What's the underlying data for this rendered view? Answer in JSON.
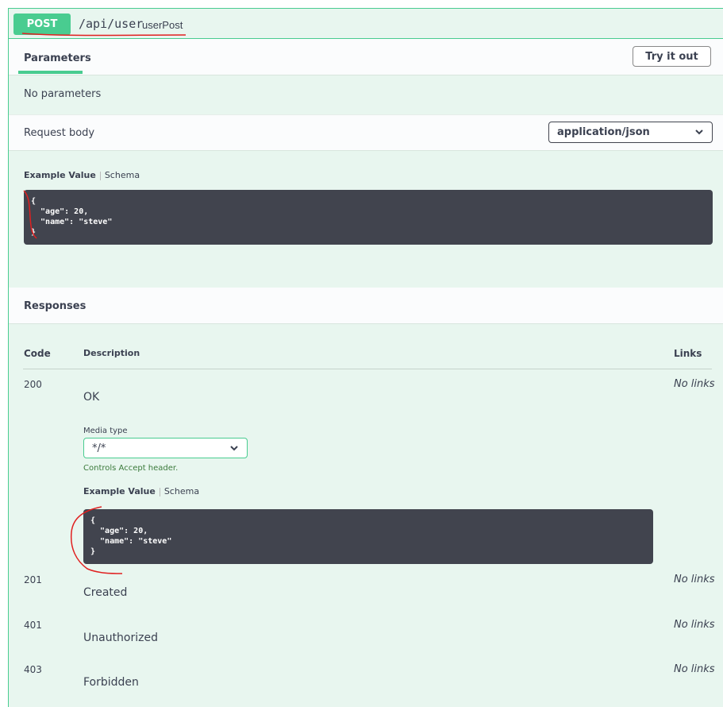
{
  "operation": {
    "method": "POST",
    "path": "/api/user",
    "operation_id": "userPost"
  },
  "parameters": {
    "tab_label": "Parameters",
    "try_button": "Try it out",
    "empty_text": "No parameters"
  },
  "request_body": {
    "label": "Request body",
    "content_type": "application/json",
    "example_tab": "Example Value",
    "schema_tab": "Schema",
    "example": "{\n  \"age\": 20,\n  \"name\": \"steve\"\n}"
  },
  "responses": {
    "title": "Responses",
    "headers": {
      "code": "Code",
      "description": "Description",
      "links": "Links"
    },
    "media_type_label": "Media type",
    "media_type_value": "*/*",
    "accept_note": "Controls Accept header.",
    "example_tab": "Example Value",
    "schema_tab": "Schema",
    "example": "{\n  \"age\": 20,\n  \"name\": \"steve\"\n}",
    "rows": [
      {
        "code": "200",
        "description": "OK",
        "links": "No links"
      },
      {
        "code": "201",
        "description": "Created",
        "links": "No links"
      },
      {
        "code": "401",
        "description": "Unauthorized",
        "links": "No links"
      },
      {
        "code": "403",
        "description": "Forbidden",
        "links": "No links"
      }
    ]
  },
  "colors": {
    "accent": "#49cc90",
    "background": "#e8f6ef",
    "code_bg": "#41444e",
    "annotation": "#e02020"
  }
}
